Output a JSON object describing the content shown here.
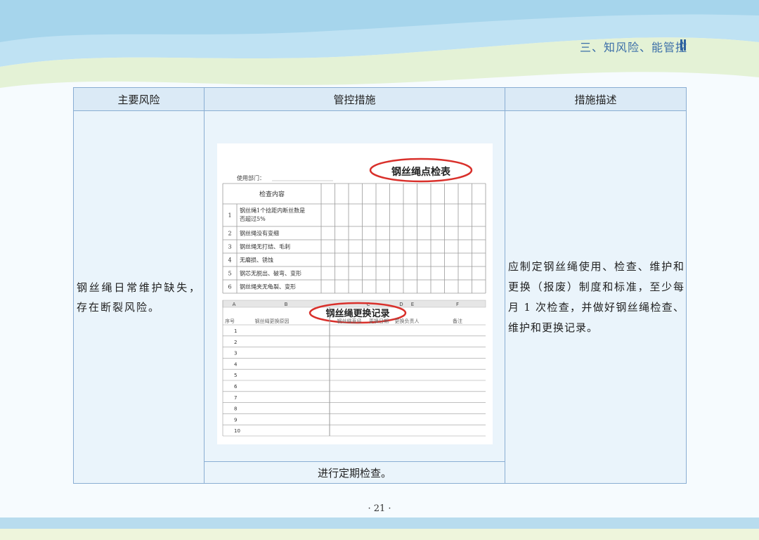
{
  "header": {
    "section_title": "三、知风险、能管控"
  },
  "table": {
    "headers": [
      "主要风险",
      "管控措施",
      "措施描述"
    ],
    "risk": "钢丝绳日常维护缺失，存在断裂风险。",
    "control_text": "进行定期检查。",
    "description": "应制定钢丝绳使用、检查、维护和更换（报废）制度和标准，至少每月 1 次检查，并做好钢丝绳检查、维护和更换记录。"
  },
  "image": {
    "inspection_form": {
      "title": "钢丝绳点检表",
      "dept_label": "使用部门：",
      "content_header": "检查内容",
      "items": [
        {
          "no": "1",
          "text": "钢丝绳1个捻距内断丝数是否超过5%"
        },
        {
          "no": "2",
          "text": "钢丝绳没有变细"
        },
        {
          "no": "3",
          "text": "钢丝绳无打结、毛刺"
        },
        {
          "no": "4",
          "text": "无磨损、锈蚀"
        },
        {
          "no": "5",
          "text": "钢芯无脱出、破弯、变形"
        },
        {
          "no": "6",
          "text": "钢丝绳夹无龟裂、变形"
        }
      ]
    },
    "replacement_record": {
      "title": "钢丝绳更换记录",
      "col_letters": [
        "A",
        "B",
        "C",
        "D",
        "E",
        "F"
      ],
      "columns": [
        "序号",
        "钢丝绳更换原因",
        "钢丝绳直径",
        "更换日期",
        "更换负责人",
        "备注"
      ],
      "rows": [
        "1",
        "2",
        "3",
        "4",
        "5",
        "6",
        "7",
        "8",
        "9",
        "10"
      ]
    }
  },
  "footer": {
    "page_number": "· 21 ·"
  }
}
